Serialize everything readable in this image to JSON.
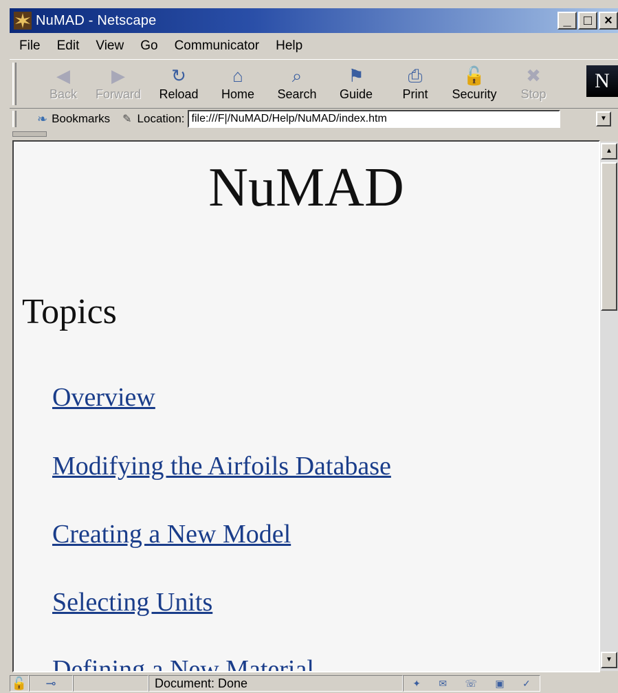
{
  "window": {
    "title": "NuMAD - Netscape",
    "min_label": "_",
    "max_label": "□",
    "close_label": "×"
  },
  "menu": [
    "File",
    "Edit",
    "View",
    "Go",
    "Communicator",
    "Help"
  ],
  "toolbar": [
    {
      "label": "Back",
      "icon": "◀",
      "enabled": false
    },
    {
      "label": "Forward",
      "icon": "▶",
      "enabled": false
    },
    {
      "label": "Reload",
      "icon": "↻",
      "enabled": true
    },
    {
      "label": "Home",
      "icon": "⌂",
      "enabled": true
    },
    {
      "label": "Search",
      "icon": "⌕",
      "enabled": true
    },
    {
      "label": "Guide",
      "icon": "⚑",
      "enabled": true
    },
    {
      "label": "Print",
      "icon": "⎙",
      "enabled": true
    },
    {
      "label": "Security",
      "icon": "🔓",
      "enabled": true
    },
    {
      "label": "Stop",
      "icon": "✖",
      "enabled": false
    }
  ],
  "logo_letter": "N",
  "location": {
    "bookmarks_label": "Bookmarks",
    "location_label": "Location:",
    "url": "file:///F|/NuMAD/Help/NuMAD/index.htm"
  },
  "page": {
    "title": "NuMAD",
    "topics_heading": "Topics",
    "links": [
      "Overview",
      "Modifying the Airfoils Database",
      "Creating a New Model",
      "Selecting Units",
      "Defining a New Material"
    ]
  },
  "status": {
    "text": "Document: Done"
  },
  "colors": {
    "link": "#1a3d8a",
    "title_bar_start": "#0c2a7a",
    "page_background": "#f6f6f6"
  }
}
